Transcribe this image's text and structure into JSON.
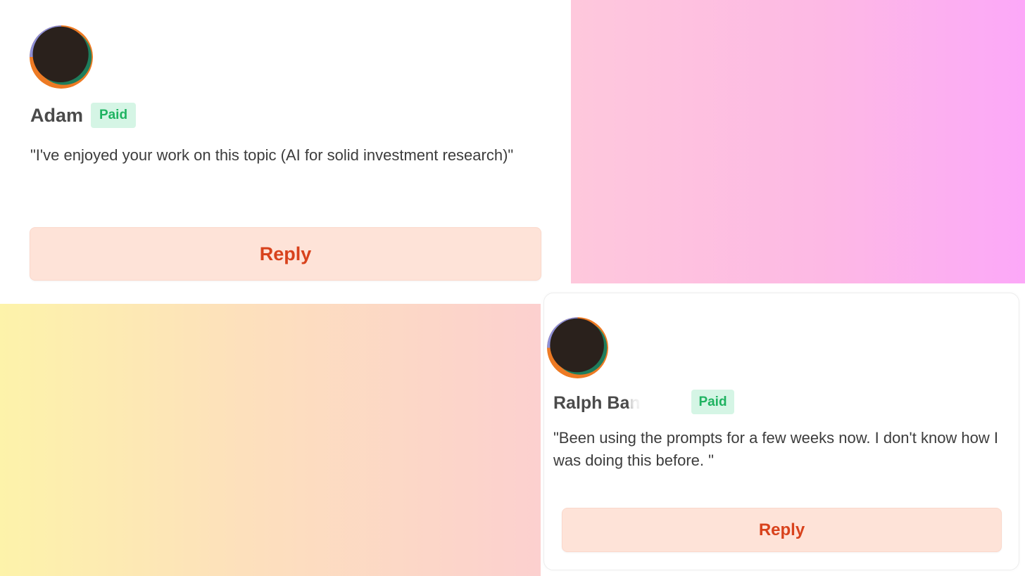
{
  "comments": [
    {
      "author": "Adam",
      "badge": "Paid",
      "text": "\"I've enjoyed your work on this topic (AI for solid investment research)\"",
      "reply_label": "Reply",
      "avatar_icon": "avatar-eclipse-icon"
    },
    {
      "author": "Ralph Ban",
      "badge": "Paid",
      "text": "\"Been using the prompts for a few weeks now. I don't know how I was doing this before. \"",
      "reply_label": "Reply",
      "avatar_icon": "avatar-eclipse-icon"
    }
  ],
  "colors": {
    "badge_bg": "#d5f5e5",
    "badge_text": "#1fb361",
    "reply_bg": "#fee3d8",
    "reply_text": "#d8421c",
    "name_text": "#4a4a4a"
  }
}
